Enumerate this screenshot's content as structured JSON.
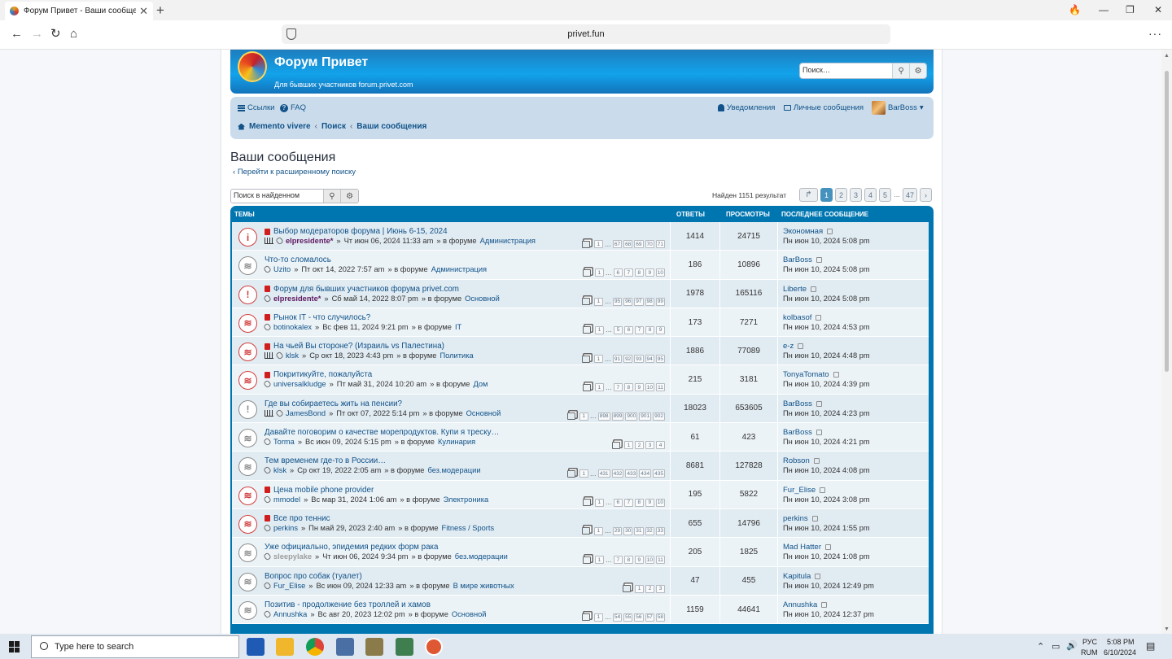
{
  "browser": {
    "tab_title": "Форум Привет - Ваши сообщения",
    "url": "privet.fun"
  },
  "header": {
    "title": "Форум Привет",
    "description": "Для бывших участников forum.privet.com",
    "search_placeholder": "Поиск…"
  },
  "navbar": {
    "links_label": "Ссылки",
    "faq_label": "FAQ",
    "notifications_label": "Уведомления",
    "messages_label": "Личные сообщения",
    "username": "BarBoss",
    "breadcrumbs": [
      "Memento vivere",
      "Поиск",
      "Ваши сообщения"
    ]
  },
  "page": {
    "title": "Ваши сообщения",
    "advanced_search": "Перейти к расширенному поиску",
    "filter_placeholder": "Поиск в найденном",
    "found_text": "Найден 1151 результат",
    "pages": [
      "1",
      "2",
      "3",
      "4",
      "5"
    ],
    "last_page": "47",
    "current_page": "1"
  },
  "table": {
    "headers": {
      "topics": "ТЕМЫ",
      "replies": "ОТВЕТЫ",
      "views": "ПРОСМОТРЫ",
      "last_post": "ПОСЛЕДНЕЕ СООБЩЕНИЕ"
    },
    "rows": [
      {
        "title": "Выбор модераторов форума | Июнь 6-15, 2024",
        "author": "elpresidente*",
        "date": "Чт июн 06, 2024 11:33 am",
        "forum": "Администрация",
        "pages": [
          "1",
          "…",
          "67",
          "68",
          "69",
          "70",
          "71"
        ],
        "replies": "1414",
        "views": "24715",
        "last_user": "Экономная",
        "last_time": "Пн июн 10, 2024 5:08 pm"
      },
      {
        "title": "Что-то сломалось",
        "author": "Uzito",
        "date": "Пт окт 14, 2022 7:57 am",
        "forum": "Администрация",
        "pages": [
          "1",
          "…",
          "6",
          "7",
          "8",
          "9",
          "10"
        ],
        "replies": "186",
        "views": "10896",
        "last_user": "BarBoss",
        "last_time": "Пн июн 10, 2024 5:08 pm"
      },
      {
        "title": "Форум для бывших участников форума privet.com",
        "author": "elpresidente*",
        "date": "Сб май 14, 2022 8:07 pm",
        "forum": "Основной",
        "pages": [
          "1",
          "…",
          "95",
          "96",
          "97",
          "98",
          "99"
        ],
        "replies": "1978",
        "views": "165116",
        "last_user": "Liberte",
        "last_time": "Пн июн 10, 2024 5:08 pm"
      },
      {
        "title": "Рынок IT - что случилось?",
        "author": "botinokalex",
        "date": "Вс фев 11, 2024 9:21 pm",
        "forum": "IT",
        "pages": [
          "1",
          "…",
          "5",
          "6",
          "7",
          "8",
          "9"
        ],
        "replies": "173",
        "views": "7271",
        "last_user": "kolbasof",
        "last_time": "Пн июн 10, 2024 4:53 pm"
      },
      {
        "title": "На чьей Вы стороне? (Израиль vs Палестина)",
        "author": "klsk",
        "date": "Ср окт 18, 2023 4:43 pm",
        "forum": "Политика",
        "pages": [
          "1",
          "…",
          "91",
          "92",
          "93",
          "94",
          "95"
        ],
        "replies": "1886",
        "views": "77089",
        "last_user": "e-z",
        "last_time": "Пн июн 10, 2024 4:48 pm"
      },
      {
        "title": "Покритикуйте, пожалуйста",
        "author": "universalkludge",
        "date": "Пт май 31, 2024 10:20 am",
        "forum": "Дом",
        "pages": [
          "1",
          "…",
          "7",
          "8",
          "9",
          "10",
          "11"
        ],
        "replies": "215",
        "views": "3181",
        "last_user": "TonyaTomato",
        "last_time": "Пн июн 10, 2024 4:39 pm"
      },
      {
        "title": "Где вы собираетесь жить на пенсии?",
        "author": "JamesBond",
        "date": "Пт окт 07, 2022 5:14 pm",
        "forum": "Основной",
        "pages": [
          "1",
          "…",
          "898",
          "899",
          "900",
          "901",
          "902"
        ],
        "replies": "18023",
        "views": "653605",
        "last_user": "BarBoss",
        "last_time": "Пн июн 10, 2024 4:23 pm"
      },
      {
        "title": "Давайте поговорим о качестве морепродуктов. Купи я треску…",
        "author": "Torma",
        "date": "Вс июн 09, 2024 5:15 pm",
        "forum": "Кулинария",
        "pages": [
          "1",
          "2",
          "3",
          "4"
        ],
        "replies": "61",
        "views": "423",
        "last_user": "BarBoss",
        "last_time": "Пн июн 10, 2024 4:21 pm"
      },
      {
        "title": "Тем временем где-то в России…",
        "author": "klsk",
        "date": "Ср окт 19, 2022 2:05 am",
        "forum": "без.модерации",
        "pages": [
          "1",
          "…",
          "431",
          "432",
          "433",
          "434",
          "435"
        ],
        "replies": "8681",
        "views": "127828",
        "last_user": "Robson",
        "last_time": "Пн июн 10, 2024 4:08 pm"
      },
      {
        "title": "Цена mobile phone provider",
        "author": "mmodel",
        "date": "Вс мар 31, 2024 1:06 am",
        "forum": "Электроника",
        "pages": [
          "1",
          "…",
          "6",
          "7",
          "8",
          "9",
          "10"
        ],
        "replies": "195",
        "views": "5822",
        "last_user": "Fur_Elise",
        "last_time": "Пн июн 10, 2024 3:08 pm"
      },
      {
        "title": "Все про теннис",
        "author": "perkins",
        "date": "Пн май 29, 2023 2:40 am",
        "forum": "Fitness / Sports",
        "pages": [
          "1",
          "…",
          "29",
          "30",
          "31",
          "32",
          "33"
        ],
        "replies": "655",
        "views": "14796",
        "last_user": "perkins",
        "last_time": "Пн июн 10, 2024 1:55 pm"
      },
      {
        "title": "Уже официально, эпидемия редких форм рака",
        "author": "sleepylake",
        "date": "Чт июн 06, 2024 9:34 pm",
        "forum": "без.модерации",
        "pages": [
          "1",
          "…",
          "7",
          "8",
          "9",
          "10",
          "11"
        ],
        "replies": "205",
        "views": "1825",
        "last_user": "Mad Hatter",
        "last_time": "Пн июн 10, 2024 1:08 pm"
      },
      {
        "title": "Вопрос про собак (туалет)",
        "author": "Fur_Elise",
        "date": "Вс июн 09, 2024 12:33 am",
        "forum": "В мире животных",
        "pages": [
          "1",
          "2",
          "3"
        ],
        "replies": "47",
        "views": "455",
        "last_user": "Kapitula",
        "last_time": "Пн июн 10, 2024 12:49 pm"
      },
      {
        "title": "Позитив - продолжение без троллей и хамов",
        "author": "Annushka",
        "date": "Вс авг 20, 2023 12:02 pm",
        "forum": "Основной",
        "pages": [
          "1",
          "…",
          "54",
          "55",
          "56",
          "57",
          "58"
        ],
        "replies": "1159",
        "views": "44641",
        "last_user": "Annushka",
        "last_time": "Пн июн 10, 2024 12:37 pm"
      }
    ]
  },
  "taskbar": {
    "search_placeholder": "Type here to search",
    "lang_top": "РУС",
    "lang_bottom": "RUM",
    "time": "5:08 PM",
    "date": "6/10/2024"
  }
}
